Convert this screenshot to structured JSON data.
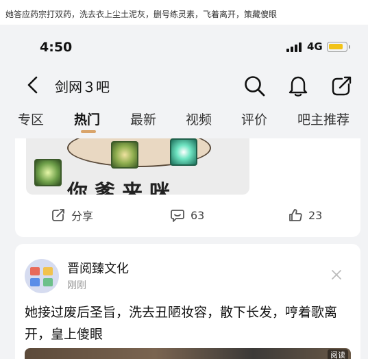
{
  "caption": "她答应药宗打双药，洗去衣上尘土泥灰，删号练灵素，飞着离开，策藏傻眼",
  "status_bar": {
    "time": "4:50",
    "network": "4G"
  },
  "header": {
    "title": "剑网３吧",
    "icons": [
      "back-icon",
      "search-icon",
      "bell-icon",
      "share-icon"
    ]
  },
  "tabs": [
    {
      "label": "专区"
    },
    {
      "label": "热门"
    },
    {
      "label": "最新"
    },
    {
      "label": "视频"
    },
    {
      "label": "评价"
    },
    {
      "label": "吧主推荐"
    }
  ],
  "post1": {
    "meme_text": "你爹来咪",
    "share_label": "分享",
    "comment_count": "63",
    "like_count": "23"
  },
  "post2": {
    "author": "晋阅臻文化",
    "time": "刚刚",
    "title": "她接过废后圣旨，洗去丑陋妆容，散下长发，哼着歌离开，皇上傻眼",
    "badge": "阅读"
  },
  "colors": {
    "accent": "#d9a46a",
    "battery": "#f2c318",
    "background": "#f2f3f5"
  }
}
